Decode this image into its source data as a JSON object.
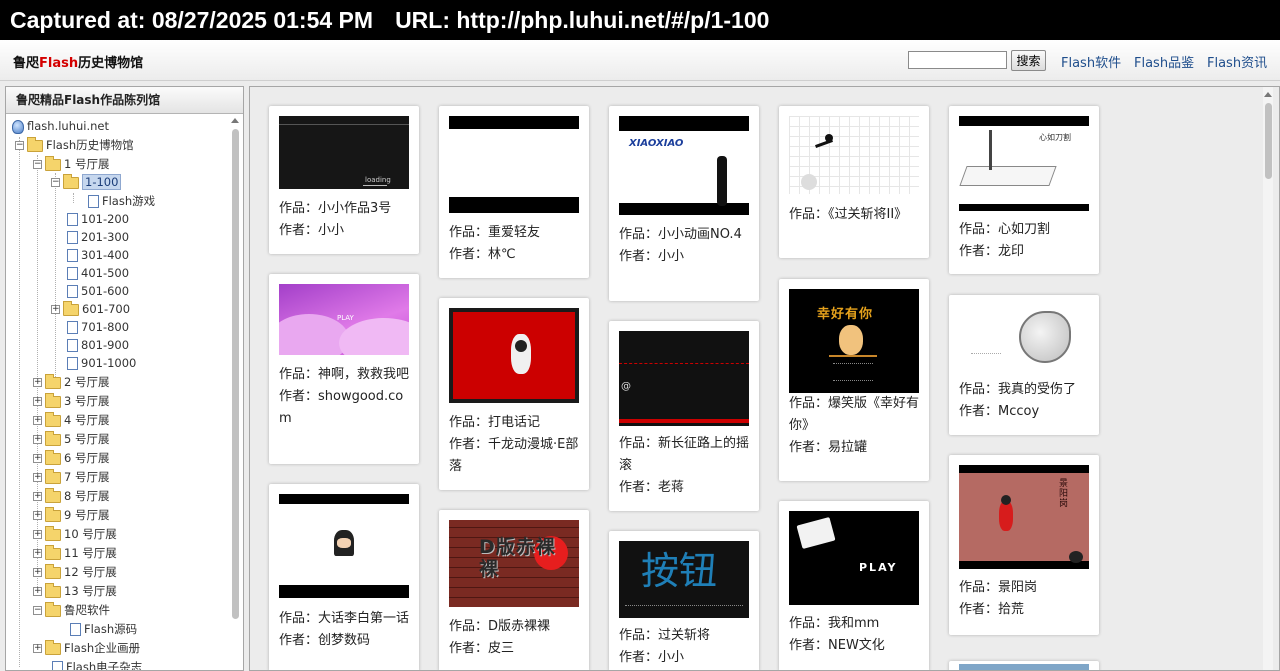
{
  "capture": {
    "time": "Captured at: 08/27/2025 01:54 PM",
    "url": "URL: http://php.luhui.net/#/p/1-100"
  },
  "header": {
    "title_a": "鲁咫",
    "title_b": "Flash",
    "title_c": "历史博物馆",
    "search_placeholder": "",
    "search_button": "搜索",
    "links": [
      "Flash软件",
      "Flash品鉴",
      "Flash资讯"
    ]
  },
  "sidebar": {
    "title": "鲁咫精品Flash作品陈列馆",
    "tree": [
      {
        "label": "flash.luhui.net"
      },
      {
        "label": "Flash历史博物馆"
      },
      {
        "label": "1 号厅展"
      },
      {
        "label": "1-100"
      },
      {
        "label": "Flash游戏"
      },
      {
        "label": "101-200"
      },
      {
        "label": "201-300"
      },
      {
        "label": "301-400"
      },
      {
        "label": "401-500"
      },
      {
        "label": "501-600"
      },
      {
        "label": "601-700"
      },
      {
        "label": "701-800"
      },
      {
        "label": "801-900"
      },
      {
        "label": "901-1000"
      },
      {
        "label": "2 号厅展"
      },
      {
        "label": "3 号厅展"
      },
      {
        "label": "4 号厅展"
      },
      {
        "label": "5 号厅展"
      },
      {
        "label": "6 号厅展"
      },
      {
        "label": "7 号厅展"
      },
      {
        "label": "8 号厅展"
      },
      {
        "label": "9 号厅展"
      },
      {
        "label": "10 号厅展"
      },
      {
        "label": "11 号厅展"
      },
      {
        "label": "12 号厅展"
      },
      {
        "label": "13 号厅展"
      },
      {
        "label": "鲁咫软件"
      },
      {
        "label": "Flash源码"
      },
      {
        "label": "Flash企业画册"
      },
      {
        "label": "Flash电子杂志"
      }
    ]
  },
  "works": [
    {
      "title": "作品：小小作品3号",
      "author": "作者：小小",
      "thumb_text": "loading"
    },
    {
      "title": "作品：神啊，救救我吧",
      "author": "作者：showgood.com",
      "thumb_text": "PLAY"
    },
    {
      "title": "作品：大话李白第一话",
      "author": "作者：创梦数码",
      "thumb_text": ""
    },
    {
      "title": "作品：重爱轻友",
      "author": "作者：林℃",
      "thumb_text": ""
    },
    {
      "title": "作品：打电话记",
      "author": "作者：千龙动漫城·E部落",
      "thumb_text": ""
    },
    {
      "title": "作品：D版赤裸裸",
      "author": "作者：皮三",
      "thumb_text": "D版赤裸裸"
    },
    {
      "title": "作品：小小动画NO.4",
      "author": "作者：小小",
      "thumb_text": "XIAOXIAO"
    },
    {
      "title": "作品：新长征路上的摇滚",
      "author": "作者：老蒋",
      "thumb_text": "@"
    },
    {
      "title": "作品：过关斩将",
      "author": "作者：小小",
      "thumb_text": "按钮"
    },
    {
      "title": "作品：《过关斩将II》",
      "author": "",
      "thumb_text": ""
    },
    {
      "title": "作品：爆笑版《幸好有你》",
      "author": "作者：易拉罐",
      "thumb_text": "幸好有你"
    },
    {
      "title": "作品：我和mm",
      "author": "作者：NEW文化",
      "thumb_text": "PLAY"
    },
    {
      "title": "作品：心如刀割",
      "author": "作者：龙印",
      "thumb_text": "心如刀割"
    },
    {
      "title": "作品：我真的受伤了",
      "author": "作者：Mccoy",
      "thumb_text": ""
    },
    {
      "title": "作品：景阳岗",
      "author": "作者：拾荒",
      "thumb_text": "景阳岗"
    }
  ]
}
